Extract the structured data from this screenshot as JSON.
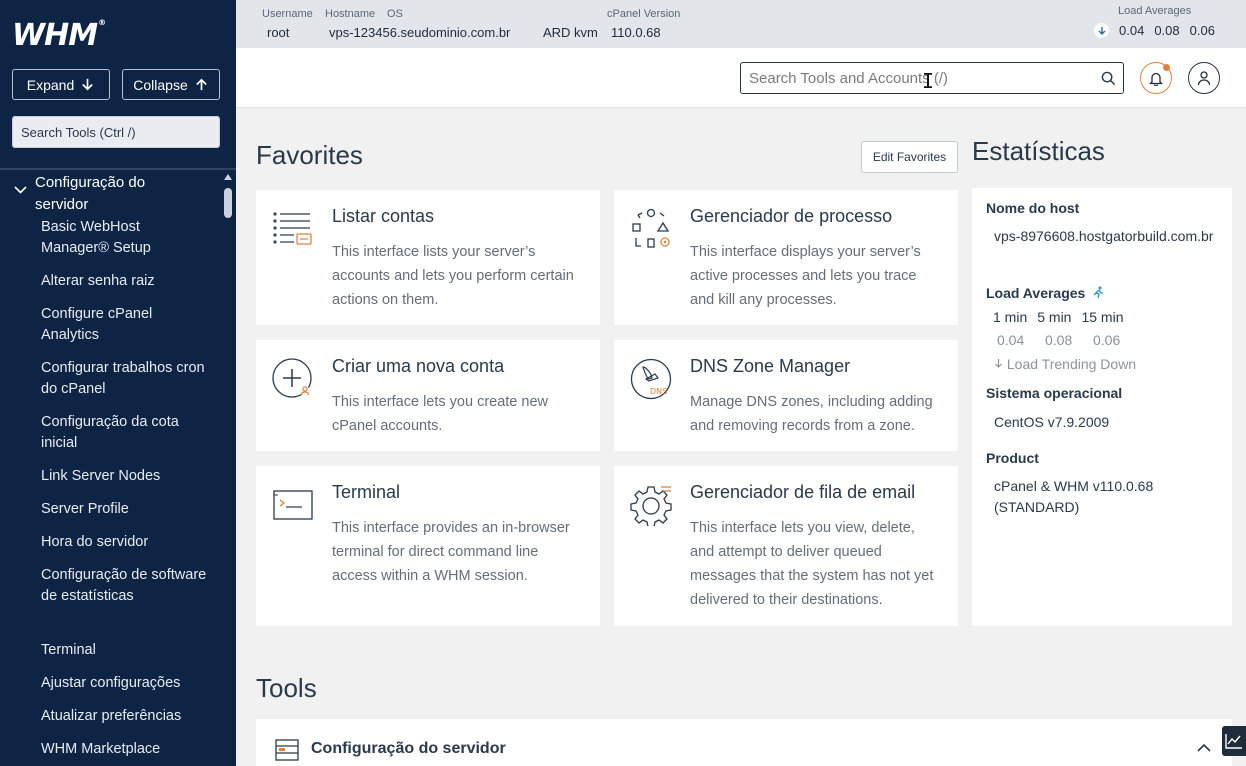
{
  "sidebar": {
    "logo": "WHM",
    "logo_mark": "®",
    "expand_label": "Expand",
    "collapse_label": "Collapse",
    "search_placeholder": "Search Tools (Ctrl /)",
    "group_label": "Configuração do servidor",
    "items": [
      "Basic WebHost Manager® Setup",
      "Alterar senha raiz",
      "Configure cPanel Analytics",
      "Configurar trabalhos cron do cPanel",
      "Configuração da cota inicial",
      "Link Server Nodes",
      "Server Profile",
      "Hora do servidor",
      "Configuração de software de estatísticas",
      "Terminal",
      "Ajustar configurações",
      "Atualizar preferências",
      "WHM Marketplace"
    ]
  },
  "statusbar": {
    "username_label": "Username",
    "username": "root",
    "hostname_label": "Hostname",
    "hostname": "vps-123456.seudominio.com.br",
    "os_label": "OS",
    "os": "ARD kvm",
    "cpanel_label": "cPanel Version",
    "cpanel_version": "110.0.68",
    "load_label": "Load Averages",
    "load": [
      "0.04",
      "0.08",
      "0.06"
    ]
  },
  "header": {
    "search_placeholder": "Search Tools and Accounts (/)"
  },
  "favorites": {
    "title": "Favorites",
    "edit_label": "Edit Favorites",
    "cards": [
      {
        "title": "Listar contas",
        "desc": "This interface lists your server’s accounts and lets you perform certain actions on them.",
        "icon": "list-accounts-icon"
      },
      {
        "title": "Gerenciador de processo",
        "desc": "This interface displays your server’s active processes and lets you trace and kill any processes.",
        "icon": "process-manager-icon"
      },
      {
        "title": "Criar uma nova conta",
        "desc": "This interface lets you create new cPanel accounts.",
        "icon": "create-account-icon"
      },
      {
        "title": "DNS Zone Manager",
        "desc": "Manage DNS zones, including adding and removing records from a zone.",
        "icon": "dns-icon"
      },
      {
        "title": "Terminal",
        "desc": "This interface provides an in-browser terminal for direct command line access within a WHM session.",
        "icon": "terminal-icon"
      },
      {
        "title": "Gerenciador de fila de email",
        "desc": "This interface lets you view, delete, and attempt to deliver queued messages that the system has not yet delivered to their destinations.",
        "icon": "mail-queue-icon"
      }
    ]
  },
  "stats": {
    "title": "Estatísticas",
    "hostname_label": "Nome do host",
    "hostname": "vps-8976608.hostgatorbuild.com.br",
    "load_label": "Load Averages",
    "load_cols": [
      "1 min",
      "5 min",
      "15 min"
    ],
    "load_vals": [
      "0.04",
      "0.08",
      "0.06"
    ],
    "trend": "Load Trending Down",
    "os_label": "Sistema operacional",
    "os": "CentOS v7.9.2009",
    "product_label": "Product",
    "product": "cPanel & WHM v110.0.68 (STANDARD)"
  },
  "tools": {
    "title": "Tools",
    "section_label": "Configuração do servidor"
  },
  "colors": {
    "sidebar_bg": "#0d2445",
    "accent_orange": "#e1823d",
    "text_dark": "#293a4a"
  }
}
